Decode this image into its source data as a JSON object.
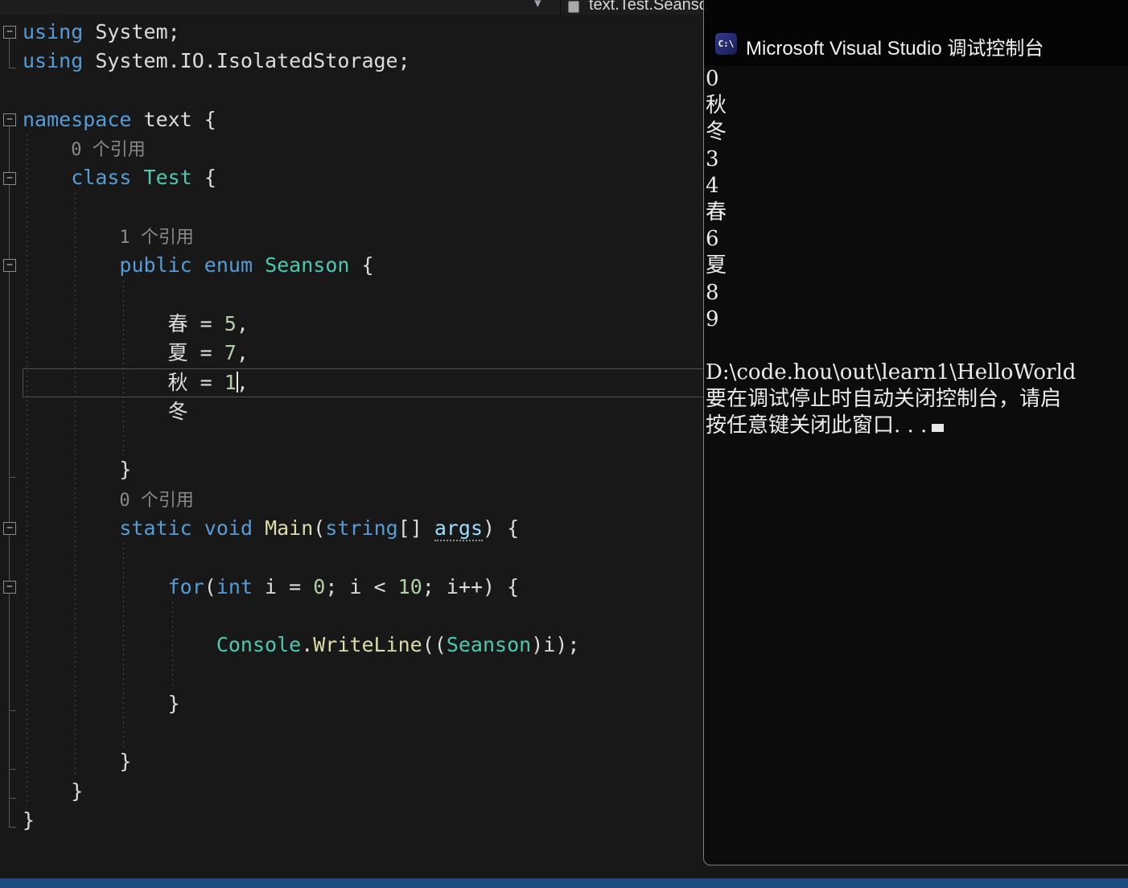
{
  "colors": {
    "kw": "#569CD6",
    "ty": "#4EC9B0",
    "me": "#DCDCAA",
    "nu": "#B5CEA8",
    "pa": "#9CDCFE",
    "pl": "#DCDCDC",
    "cl": "#8A8A8A",
    "statusbar": "#1B4C82",
    "editor_bg": "#181818",
    "console_bg": "#0C0C0C"
  },
  "navbar": {
    "dropdown_glyph": "▾",
    "symbol_icon": "enum-icon",
    "path": "text.Test.Seanson"
  },
  "editor": {
    "lines": [
      {
        "indent": 0,
        "tokens": [
          [
            "kw",
            "using"
          ],
          [
            "pl",
            " System;"
          ]
        ]
      },
      {
        "indent": 0,
        "tokens": [
          [
            "kw",
            "using"
          ],
          [
            "pl",
            " System.IO.IsolatedStorage;"
          ]
        ]
      },
      {
        "indent": 0,
        "tokens": []
      },
      {
        "indent": 0,
        "tokens": [
          [
            "kw",
            "namespace"
          ],
          [
            "pl",
            " text {"
          ]
        ]
      },
      {
        "indent": 4,
        "codelens": true,
        "tokens": [
          [
            "cl",
            "0 个引用"
          ]
        ]
      },
      {
        "indent": 4,
        "tokens": [
          [
            "kw",
            "class"
          ],
          [
            "pl",
            " "
          ],
          [
            "ty",
            "Test"
          ],
          [
            "pl",
            " {"
          ]
        ]
      },
      {
        "indent": 0,
        "tokens": []
      },
      {
        "indent": 8,
        "codelens": true,
        "tokens": [
          [
            "cl",
            "1 个引用"
          ]
        ]
      },
      {
        "indent": 8,
        "tokens": [
          [
            "kw",
            "public"
          ],
          [
            "pl",
            " "
          ],
          [
            "kw",
            "enum"
          ],
          [
            "pl",
            " "
          ],
          [
            "ty",
            "Seanson"
          ],
          [
            "pl",
            " {"
          ]
        ]
      },
      {
        "indent": 0,
        "tokens": []
      },
      {
        "indent": 12,
        "tokens": [
          [
            "pl",
            "春 = "
          ],
          [
            "nu",
            "5"
          ],
          [
            "pl",
            ","
          ]
        ]
      },
      {
        "indent": 12,
        "tokens": [
          [
            "pl",
            "夏 = "
          ],
          [
            "nu",
            "7"
          ],
          [
            "pl",
            ","
          ]
        ]
      },
      {
        "indent": 12,
        "current": true,
        "tokens": [
          [
            "pl",
            "秋 = "
          ],
          [
            "nu",
            "1"
          ],
          [
            "cur",
            ""
          ],
          [
            "pl",
            ","
          ]
        ]
      },
      {
        "indent": 12,
        "tokens": [
          [
            "pl",
            "冬"
          ]
        ]
      },
      {
        "indent": 0,
        "tokens": []
      },
      {
        "indent": 8,
        "tokens": [
          [
            "pl",
            "}"
          ]
        ]
      },
      {
        "indent": 8,
        "codelens": true,
        "tokens": [
          [
            "cl",
            "0 个引用"
          ]
        ]
      },
      {
        "indent": 8,
        "tokens": [
          [
            "kw",
            "static"
          ],
          [
            "pl",
            " "
          ],
          [
            "kw",
            "void"
          ],
          [
            "pl",
            " "
          ],
          [
            "me",
            "Main"
          ],
          [
            "pl",
            "("
          ],
          [
            "kw",
            "string"
          ],
          [
            "pl",
            "[] "
          ],
          [
            "pa",
            "args"
          ],
          [
            "pl",
            ") {"
          ]
        ]
      },
      {
        "indent": 0,
        "tokens": []
      },
      {
        "indent": 12,
        "tokens": [
          [
            "kw",
            "for"
          ],
          [
            "pl",
            "("
          ],
          [
            "kw",
            "int"
          ],
          [
            "pl",
            " i = "
          ],
          [
            "nu",
            "0"
          ],
          [
            "pl",
            "; i < "
          ],
          [
            "nu",
            "10"
          ],
          [
            "pl",
            "; i++) {"
          ]
        ]
      },
      {
        "indent": 0,
        "tokens": []
      },
      {
        "indent": 16,
        "tokens": [
          [
            "ty",
            "Console"
          ],
          [
            "pl",
            "."
          ],
          [
            "me",
            "WriteLine"
          ],
          [
            "pl",
            "(("
          ],
          [
            "ty",
            "Seanson"
          ],
          [
            "pl",
            ")i);"
          ]
        ]
      },
      {
        "indent": 0,
        "tokens": []
      },
      {
        "indent": 12,
        "tokens": [
          [
            "pl",
            "}"
          ]
        ]
      },
      {
        "indent": 0,
        "tokens": []
      },
      {
        "indent": 8,
        "tokens": [
          [
            "pl",
            "}"
          ]
        ]
      },
      {
        "indent": 4,
        "tokens": [
          [
            "pl",
            "}"
          ]
        ]
      },
      {
        "indent": 0,
        "tokens": [
          [
            "pl",
            "}"
          ]
        ]
      }
    ],
    "fold": {
      "glyph": "−",
      "boxes": [
        1,
        4,
        6,
        9,
        18,
        20
      ],
      "ticks": [
        2,
        16,
        24,
        26,
        27,
        28
      ],
      "lines": [
        [
          1,
          2
        ],
        [
          4,
          28
        ]
      ]
    },
    "guides": [
      {
        "col": 0,
        "from": 5,
        "to": 27
      },
      {
        "col": 4,
        "from": 7,
        "to": 26
      },
      {
        "col": 8,
        "from": 10,
        "to": 15
      },
      {
        "col": 8,
        "from": 19,
        "to": 25
      },
      {
        "col": 12,
        "from": 21,
        "to": 23
      }
    ]
  },
  "console": {
    "title": "Microsoft Visual Studio 调试控制台",
    "icon_label": "C:\\",
    "lines": [
      "0",
      "秋",
      "冬",
      "3",
      "4",
      "春",
      "6",
      "夏",
      "8",
      "9",
      "",
      "D:\\code.hou\\out\\learn1\\HelloWorld",
      "要在调试停止时自动关闭控制台，请启",
      "按任意键关闭此窗口. . ."
    ],
    "cursor_after_last_line": true
  }
}
